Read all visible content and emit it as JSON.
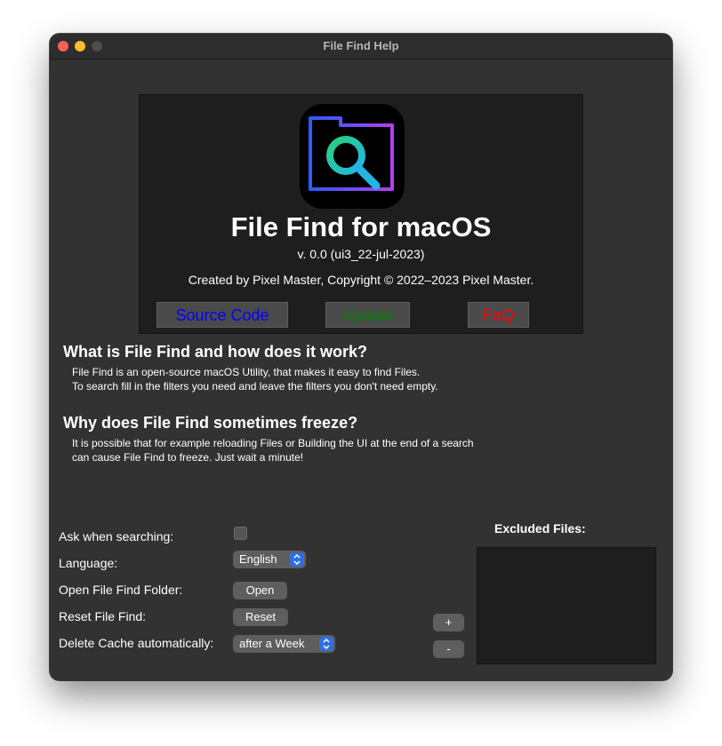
{
  "window": {
    "title": "File Find Help"
  },
  "header": {
    "app_name": "File Find for macOS",
    "version": "v. 0.0 (ui3_22-jul-2023)",
    "created_by": "Created by Pixel Master, Copyright © 2022–2023 Pixel Master.",
    "links": {
      "source_code": "Source Code",
      "update": "Update",
      "faq": "FaQ"
    },
    "link_colors": {
      "source_code": "#0000ff",
      "update": "#008000",
      "faq": "#ff0000"
    }
  },
  "sections": [
    {
      "heading": "What is File Find and how does it work?",
      "lines": [
        "File Find is an open-source macOS Utility, that makes it easy to find Files.",
        "To search fill in the filters you need and leave the filters you don't need empty."
      ]
    },
    {
      "heading": "Why does File Find sometimes freeze?",
      "lines": [
        "It is possible that for example reloading Files or Building the UI at the end of a search",
        "can cause File Find to freeze. Just wait a minute!"
      ]
    }
  ],
  "settings": {
    "ask_when_searching_label": "Ask when searching:",
    "ask_when_searching_checked": false,
    "language_label": "Language:",
    "language_value": "English",
    "open_folder_label": "Open File Find Folder:",
    "open_button": "Open",
    "reset_label": "Reset File Find:",
    "reset_button": "Reset",
    "delete_cache_label": "Delete Cache automatically:",
    "delete_cache_value": "after a Week"
  },
  "excluded": {
    "label": "Excluded Files:",
    "add_button": "+",
    "remove_button": "-",
    "items": []
  },
  "icons": {
    "window_close": "close-traffic-light",
    "window_minimize": "minimize-traffic-light",
    "window_zoom": "zoom-traffic-light",
    "app": "folder-search-icon",
    "popup": "chevron-up-down-icon"
  },
  "colors": {
    "window_bg": "#323232",
    "panel_bg": "#1e1e1e",
    "accent": "#2f6fe0"
  }
}
